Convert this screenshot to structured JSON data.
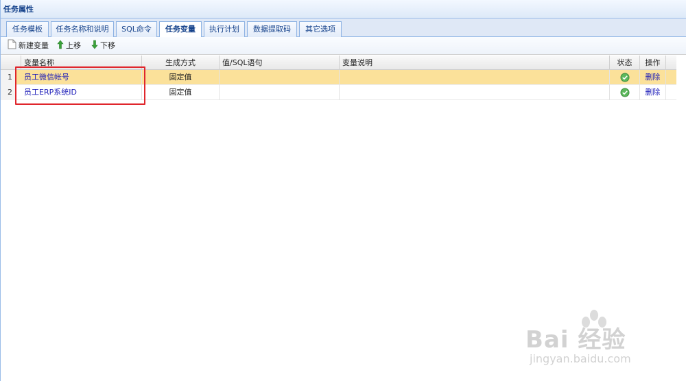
{
  "panel": {
    "title": "任务属性"
  },
  "tabs": [
    {
      "label": "任务模板"
    },
    {
      "label": "任务名称和说明"
    },
    {
      "label": "SQL命令"
    },
    {
      "label": "任务变量"
    },
    {
      "label": "执行计划"
    },
    {
      "label": "数据提取码"
    },
    {
      "label": "其它选项"
    }
  ],
  "active_tab": "任务变量",
  "toolbar": {
    "new_label": "新建变量",
    "up_label": "上移",
    "down_label": "下移"
  },
  "grid": {
    "columns": [
      "变量名称",
      "生成方式",
      "值/SQL语句",
      "变量说明",
      "状态",
      "操作"
    ],
    "rows": [
      {
        "num": "1",
        "name": "员工微信帐号",
        "mode": "固定值",
        "value": "",
        "desc": "",
        "status": "ok",
        "action": "删除"
      },
      {
        "num": "2",
        "name": "员工ERP系统ID",
        "mode": "固定值",
        "value": "",
        "desc": "",
        "status": "ok",
        "action": "删除"
      }
    ]
  },
  "colors": {
    "accent": "#15428b",
    "selected_row": "#fbe19a",
    "highlight_box": "#e0262c",
    "link": "#1a1ab8"
  },
  "watermark": {
    "main": "Bai 经验",
    "sub": "jingyan.baidu.com"
  }
}
